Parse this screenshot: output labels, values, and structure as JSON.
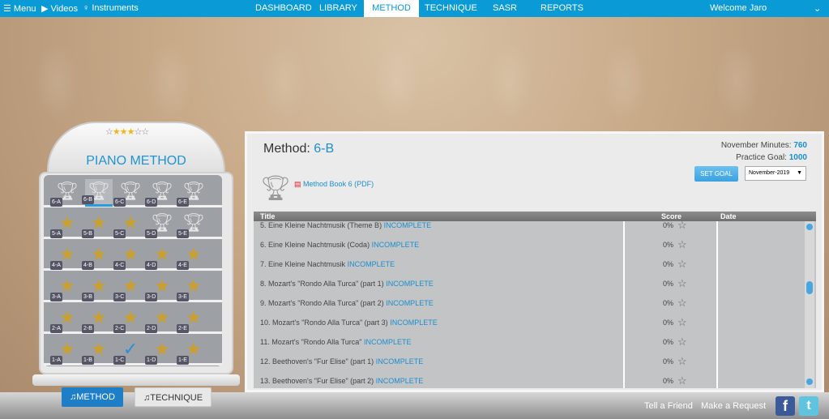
{
  "topbar": {
    "menu": "Menu",
    "videos": "Videos",
    "instruments": "Instruments",
    "welcome": "Welcome Jaro",
    "nav": [
      "DASHBOARD",
      "LIBRARY",
      "METHOD",
      "TECHNIQUE",
      "SASR",
      "REPORTS"
    ],
    "active": "METHOD"
  },
  "bookcase": {
    "title": "PIANO METHOD",
    "rating": 3,
    "rating_max": 6,
    "shelves": [
      [
        {
          "l": "6-A",
          "t": "trophy"
        },
        {
          "l": "6-B",
          "t": "trophy-selected"
        },
        {
          "l": "6-C",
          "t": "trophy"
        },
        {
          "l": "6-D",
          "t": "trophy"
        },
        {
          "l": "6-E",
          "t": "trophy"
        }
      ],
      [
        {
          "l": "5-A",
          "t": "piano"
        },
        {
          "l": "5-B",
          "t": "piano"
        },
        {
          "l": "5-C",
          "t": "piano"
        },
        {
          "l": "5-D",
          "t": "trophy"
        },
        {
          "l": "5-E",
          "t": "trophy"
        }
      ],
      [
        {
          "l": "4-A",
          "t": "piano"
        },
        {
          "l": "4-B",
          "t": "piano"
        },
        {
          "l": "4-C",
          "t": "piano"
        },
        {
          "l": "4-D",
          "t": "piano"
        },
        {
          "l": "4-E",
          "t": "piano"
        }
      ],
      [
        {
          "l": "3-A",
          "t": "piano"
        },
        {
          "l": "3-B",
          "t": "piano"
        },
        {
          "l": "3-C",
          "t": "piano"
        },
        {
          "l": "3-D",
          "t": "piano"
        },
        {
          "l": "3-E",
          "t": "piano"
        }
      ],
      [
        {
          "l": "2-A",
          "t": "piano"
        },
        {
          "l": "2-B",
          "t": "piano"
        },
        {
          "l": "2-C",
          "t": "piano"
        },
        {
          "l": "2-D",
          "t": "piano"
        },
        {
          "l": "2-E",
          "t": "piano"
        }
      ],
      [
        {
          "l": "1-A",
          "t": "piano"
        },
        {
          "l": "1-B",
          "t": "piano"
        },
        {
          "l": "1-C",
          "t": "check"
        },
        {
          "l": "1-D",
          "t": "piano"
        },
        {
          "l": "1-E",
          "t": "piano"
        }
      ]
    ]
  },
  "footer": {
    "method": "METHOD",
    "technique": "TECHNIQUE",
    "tell": "Tell a Friend",
    "request": "Make a Request"
  },
  "panel": {
    "label": "Method:",
    "level": "6-B",
    "minutes_label": "November Minutes:",
    "minutes": "760",
    "goal_label": "Practice Goal:",
    "goal": "1000",
    "set_goal": "SET GOAL",
    "month": "November-2019",
    "book": "Method Book 6 (PDF)",
    "headers": {
      "title": "Title",
      "score": "Score",
      "date": "Date"
    },
    "rows": [
      {
        "title": "5. Eine Kleine Nachtmusik (Theme B)",
        "status": "INCOMPLETE",
        "score": "0%"
      },
      {
        "title": "6. Eine Kleine Nachtmusik (Coda)",
        "status": "INCOMPLETE",
        "score": "0%"
      },
      {
        "title": "7. Eine Kleine Nachtmusik",
        "status": "INCOMPLETE",
        "score": "0%"
      },
      {
        "title": "8. Mozart's \"Rondo Alla Turca\" (part 1)",
        "status": "INCOMPLETE",
        "score": "0%"
      },
      {
        "title": "9. Mozart's \"Rondo Alla Turca\" (part 2)",
        "status": "INCOMPLETE",
        "score": "0%"
      },
      {
        "title": "10. Mozart's \"Rondo Alla Turca\" (part 3)",
        "status": "INCOMPLETE",
        "score": "0%"
      },
      {
        "title": "11. Mozart's \"Rondo Alla Turca\"",
        "status": "INCOMPLETE",
        "score": "0%"
      },
      {
        "title": "12. Beethoven's \"Fur Elise\" (part 1)",
        "status": "INCOMPLETE",
        "score": "0%"
      },
      {
        "title": "13. Beethoven's \"Fur Elise\" (part 2)",
        "status": "INCOMPLETE",
        "score": "0%"
      }
    ]
  }
}
